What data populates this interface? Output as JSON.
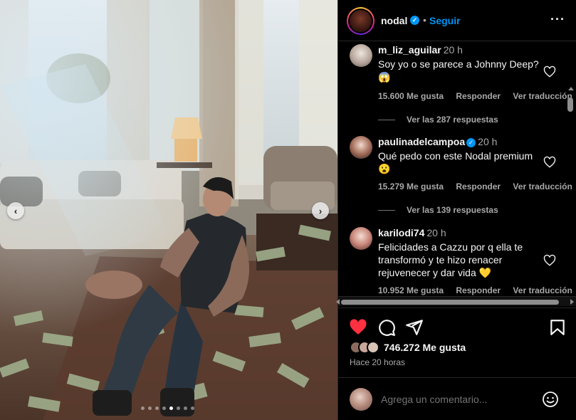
{
  "post": {
    "carousel": {
      "dot_count": 8,
      "active_dot": 4
    }
  },
  "header": {
    "username": "nodal",
    "verified_mark": "✓",
    "separator": "•",
    "follow_label": "Seguir",
    "more_label": "···"
  },
  "comments": [
    {
      "username": "m_liz_aguilar",
      "verified": false,
      "time": "20 h",
      "text": "Soy yo o se parece a Johnny Deep? 😱",
      "likes": "15.600 Me gusta",
      "reply_label": "Responder",
      "translate_label": "Ver traducción",
      "replies_label": "Ver las 287 respuestas"
    },
    {
      "username": "paulinadelcampoa",
      "verified": true,
      "time": "20 h",
      "text": "Qué pedo con este Nodal premium 😮",
      "likes": "15.279 Me gusta",
      "reply_label": "Responder",
      "translate_label": "Ver traducción",
      "replies_label": "Ver las 139 respuestas"
    },
    {
      "username": "karilodi74",
      "verified": false,
      "time": "20 h",
      "text": "Felicidades a Cazzu por q ella te transformó y te hizo renacer rejuvenecer y dar vida 💛",
      "likes": "10.952 Me gusta",
      "reply_label": "Responder",
      "translate_label": "Ver traducción"
    }
  ],
  "actions": {
    "like_icon": "heart-filled-icon",
    "comment_icon": "comment-icon",
    "share_icon": "send-icon",
    "save_icon": "bookmark-icon",
    "like_color": "#ff3040",
    "likes_count": "746.272 Me gusta",
    "time_ago": "Hace 20 horas"
  },
  "add_comment": {
    "placeholder": "Agrega un comentario...",
    "emoji_icon": "smiley-icon"
  },
  "colors": {
    "accent": "#0095f6",
    "secondary_text": "#a8a8a8",
    "border": "#262626"
  }
}
